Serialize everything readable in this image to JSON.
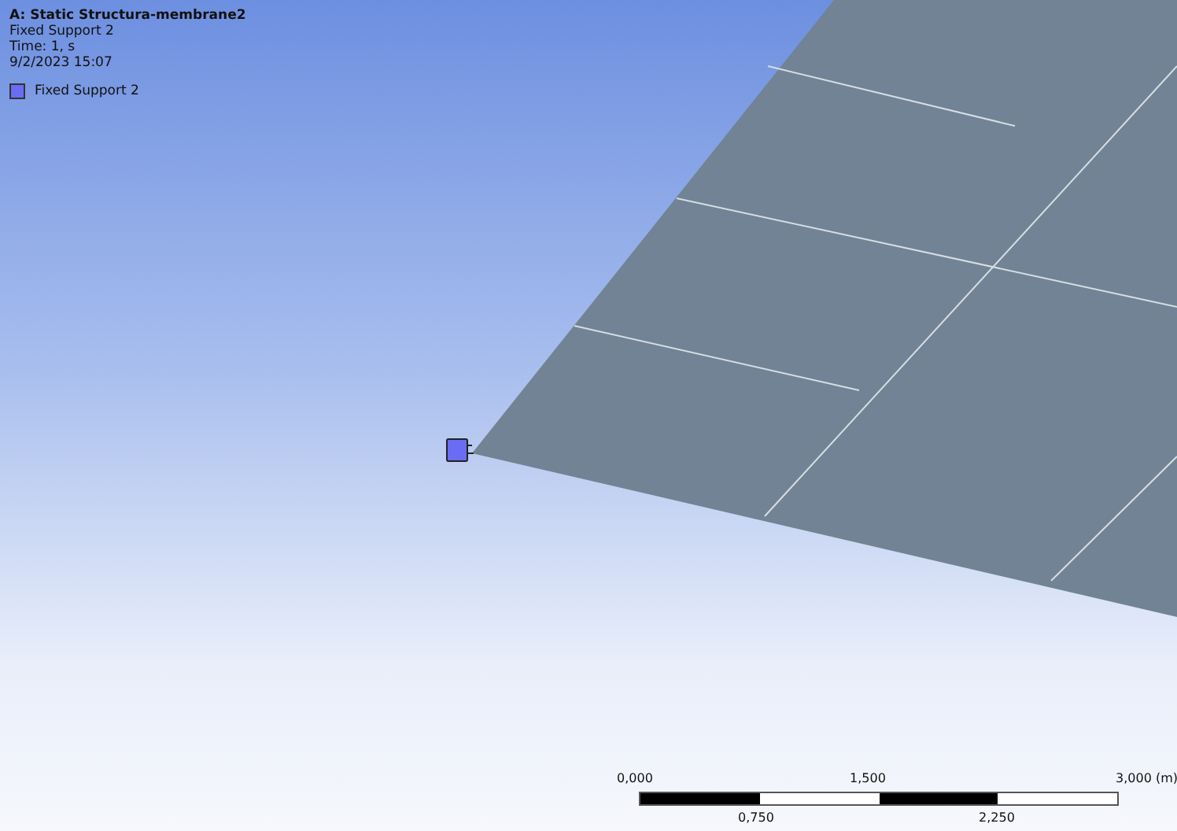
{
  "viewport": {
    "title": "A: Static Structura-membrane2",
    "info": [
      "Fixed Support 2",
      "Time: 1, s",
      "9/2/2023 15:07"
    ]
  },
  "legend": [
    {
      "label": "Fixed Support 2",
      "color": "#6a6cf4"
    }
  ],
  "scale_bar": {
    "top_labels": [
      "0,000",
      "1,500",
      "3,000 (m)"
    ],
    "bottom_labels": [
      "0,750",
      "2,250"
    ]
  }
}
